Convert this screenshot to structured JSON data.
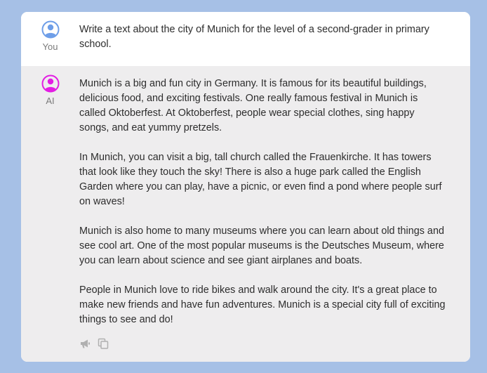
{
  "conversation": {
    "user": {
      "label": "You",
      "avatar_color": "#6e9ee8",
      "message": "Write a text about the city of Munich for the level of a second-grader in primary school."
    },
    "ai": {
      "label": "AI",
      "avatar_color": "#e31de3",
      "paragraphs": [
        "Munich is a big and fun city in Germany. It is famous for its beautiful buildings, delicious food, and exciting festivals. One really famous festival in Munich is called Oktoberfest. At Oktoberfest, people wear special clothes, sing happy songs, and eat yummy pretzels.",
        "In Munich, you can visit a big, tall church called the Frauenkirche. It has towers that look like they touch the sky! There is also a huge park called the English Garden where you can play, have a picnic, or even find a pond where people surf on waves!",
        "Munich is also home to many museums where you can learn about old things and see cool art. One of the most popular museums is the Deutsches Museum, where you can learn about science and see giant airplanes and boats.",
        "People in Munich love to ride bikes and walk around the city. It's a great place to make new friends and have fun adventures. Munich is a special city full of exciting things to see and do!"
      ],
      "actions": [
        {
          "icon": "megaphone-icon"
        },
        {
          "icon": "copy-icon"
        }
      ]
    }
  },
  "colors": {
    "page_background": "#a6c0e6",
    "ai_row_background": "#eeedee",
    "icon_gray": "#b0b0b0"
  }
}
